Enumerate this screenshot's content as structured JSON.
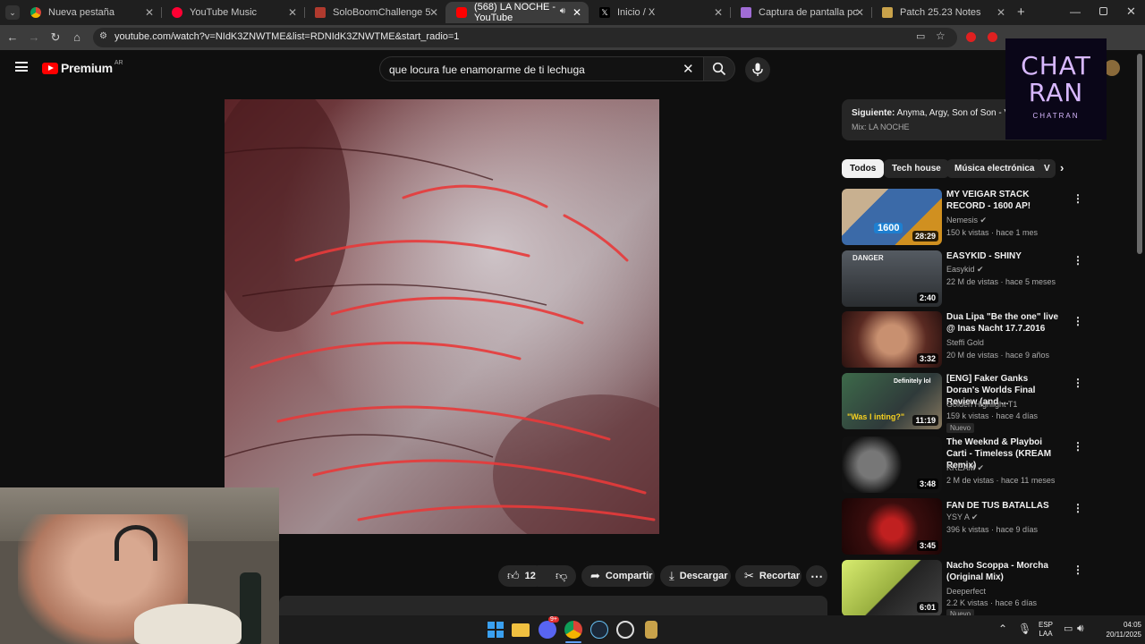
{
  "browser": {
    "tabs": [
      {
        "label": "Nueva pestaña",
        "favicon": "chrome-icon",
        "active": false
      },
      {
        "label": "YouTube Music",
        "favicon": "youtube-music-icon",
        "active": false
      },
      {
        "label": "SoloBoomChallenge 5",
        "favicon": "soloboom-icon",
        "active": false
      },
      {
        "label": "(568) LA NOCHE - YouTube",
        "favicon": "youtube-icon",
        "active": true
      },
      {
        "label": "Inicio / X",
        "favicon": "x-icon",
        "active": false
      },
      {
        "label": "Captura de pantalla por Lightsh",
        "favicon": "lightshot-icon",
        "active": false
      },
      {
        "label": "Patch 25.23 Notes",
        "favicon": "league-icon",
        "active": false
      }
    ],
    "url": "youtube.com/watch?v=NIdK3ZNWTME&list=RDNIdK3ZNWTME&start_radio=1"
  },
  "youtube": {
    "logo_text": "Premium",
    "region": "AR",
    "search_value": "que locura fue enamorarme de ti lechuga",
    "actions": {
      "likes": "12 k",
      "share": "Compartir",
      "download": "Descargar",
      "clip": "Recortar"
    },
    "next_up": {
      "prefix": "Siguiente:",
      "title": "Anyma, Argy, Son of Son - Voic",
      "mix": "Mix: LA NOCHE"
    },
    "chips": [
      "Todos",
      "Tech house",
      "Música electrónica",
      "V"
    ],
    "recommendations": [
      {
        "title": "MY VEIGAR STACK RECORD - 1600 AP!",
        "channel": "Nemesis",
        "verified": true,
        "meta": "150 k vistas · hace 1 mes",
        "duration": "28:29",
        "badge": "",
        "thumb_color": "#3b6aa8"
      },
      {
        "title": "EASYKID - SHINY",
        "channel": "Easykid",
        "verified": true,
        "meta": "22 M de vistas · hace 5 meses",
        "duration": "2:40",
        "badge": "",
        "thumb_color": "#3a3f44"
      },
      {
        "title": "Dua Lipa \"Be the one\" live @ Inas Nacht 17.7.2016",
        "channel": "Steffi Gold",
        "verified": false,
        "meta": "20 M de vistas · hace 9 años",
        "duration": "3:32",
        "badge": "",
        "thumb_color": "#5a2a22"
      },
      {
        "title": "[ENG] Faker Ganks Doran's Worlds Final Review (and ...",
        "channel": "Golden Highlight T1",
        "verified": false,
        "meta": "159 k vistas · hace 4 días",
        "duration": "11:19",
        "badge": "Nuevo",
        "thumb_color": "#2f4a3a"
      },
      {
        "title": "The Weeknd & Playboi Carti - Timeless (KREAM Remix)",
        "channel": "KREAM",
        "verified": true,
        "meta": "2 M de vistas · hace 11 meses",
        "duration": "3:48",
        "badge": "",
        "thumb_color": "#1a1a1a"
      },
      {
        "title": "FAN DE TUS BATALLAS",
        "channel": "YSY A",
        "verified": true,
        "meta": "396 k vistas · hace 9 días",
        "duration": "3:45",
        "badge": "",
        "thumb_color": "#3a0d0d"
      },
      {
        "title": "Nacho Scoppa - Morcha (Original Mix)",
        "channel": "Deeperfect",
        "verified": false,
        "meta": "2.2 K vistas · hace 6 días",
        "duration": "6:01",
        "badge": "Nuevo",
        "thumb_color": "#c8e060"
      }
    ],
    "thumb_overlays": {
      "veigar": "1600",
      "easykid": "DANGER",
      "faker_top": "Definitely lol",
      "faker_bottom": "\"Was I inting?\""
    }
  },
  "overlay": {
    "line1": "CHAT",
    "line2": "RAN",
    "line3": "CHATRAN"
  },
  "taskbar": {
    "lang": "ESP",
    "layout": "LAA",
    "time": "04:05",
    "date": "20/11/2025",
    "discord_badge": "9+"
  },
  "colors": {
    "yt_red": "#ff0000",
    "bg": "#0f0f0f",
    "chip_bg": "#272727",
    "text_secondary": "#aaaaaa"
  }
}
